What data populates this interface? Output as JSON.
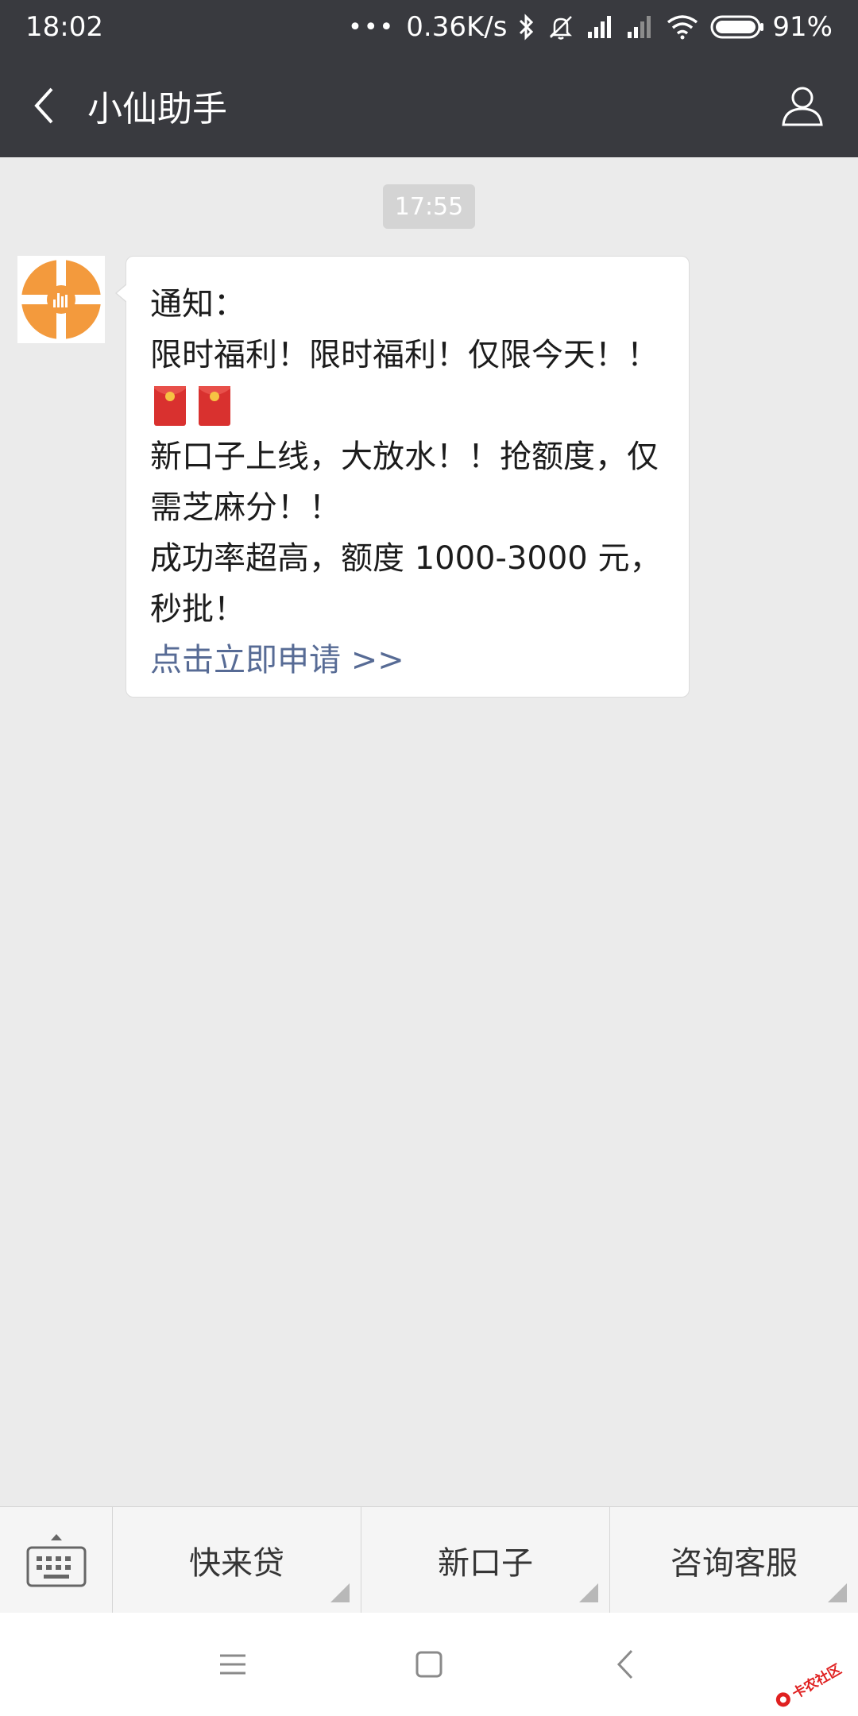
{
  "status_bar": {
    "time": "18:02",
    "dots": "•••",
    "network_speed": "0.36K/s",
    "battery_percent": "91%",
    "icons": [
      "bluetooth-icon",
      "mute-bell-icon",
      "signal-icon",
      "signal-icon-2",
      "wifi-icon",
      "battery-icon"
    ]
  },
  "header": {
    "title": "小仙助手",
    "back_icon": "chevron-left-icon",
    "profile_icon": "person-icon"
  },
  "chat": {
    "timestamp": "17:55",
    "message": {
      "lines": [
        "通知：",
        "限时福利！限时福利！仅限今天！！",
        "新口子上线，大放水！！抢额度，仅",
        "需芝麻分！！",
        "成功率超高，额度 1000-3000 元，",
        "秒批！"
      ],
      "link": "点击立即申请 >>",
      "emoji": [
        "red-envelope-icon",
        "red-envelope-icon"
      ]
    },
    "colors": {
      "accent_orange": "#f39a3d",
      "link_blue": "#576b95",
      "envelope_red": "#d9312f"
    }
  },
  "menu": {
    "items": [
      "快来贷",
      "新口子",
      "咨询客服"
    ]
  },
  "watermark": {
    "text": "卡农社区"
  }
}
